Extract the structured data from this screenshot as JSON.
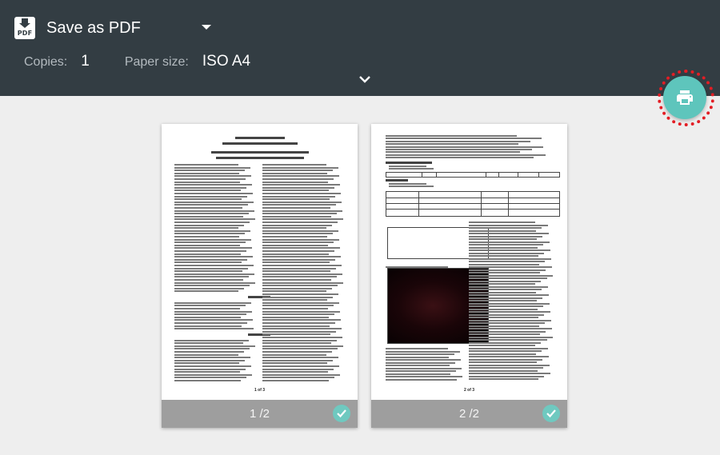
{
  "header": {
    "destination_icon": "pdf-download-icon",
    "destination_icon_text": "PDF",
    "destination": "Save as PDF",
    "copies_label": "Copies:",
    "copies_value": "1",
    "paper_size_label": "Paper size:",
    "paper_size_value": "ISO A4",
    "expand_icon": "chevron-down-icon"
  },
  "print_button": {
    "icon": "printer-icon"
  },
  "pages": [
    {
      "label": "1 /2",
      "check_icon": "check-circle-icon",
      "doc_footer": "1 of 3"
    },
    {
      "label": "2 /2",
      "check_icon": "check-circle-icon",
      "doc_footer": "2 of 3"
    }
  ],
  "colors": {
    "header_bg": "#333d43",
    "accent": "#5ec5bc",
    "highlight_ring": "#e31d24",
    "page_footer_bg": "#9e9e9e"
  }
}
